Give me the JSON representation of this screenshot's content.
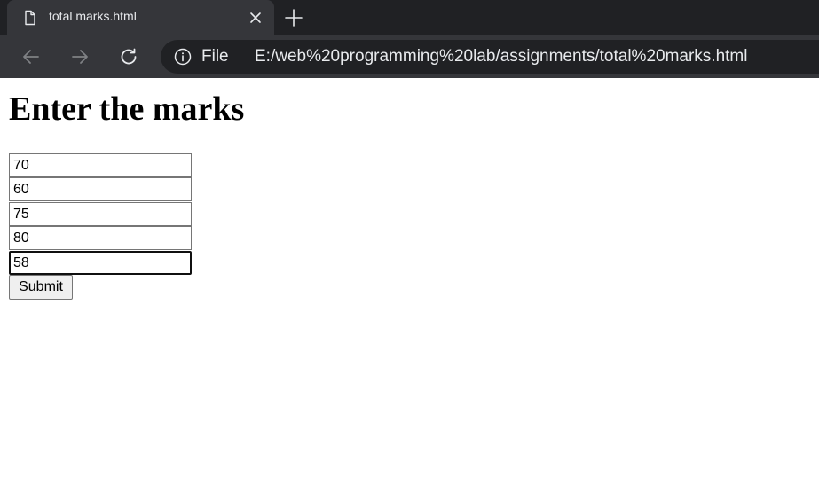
{
  "browser": {
    "tab": {
      "title": "total marks.html",
      "icon": "file-icon"
    },
    "toolbar": {
      "scheme_label": "File",
      "url": "E:/web%20programming%20lab/assignments/total%20marks.html"
    },
    "colors": {
      "frame": "#202124",
      "toolbar": "#35363a",
      "text": "#e8eaed"
    }
  },
  "page": {
    "heading": "Enter the marks",
    "marks": [
      "70",
      "60",
      "75",
      "80",
      "58"
    ],
    "submit_label": "Submit"
  }
}
